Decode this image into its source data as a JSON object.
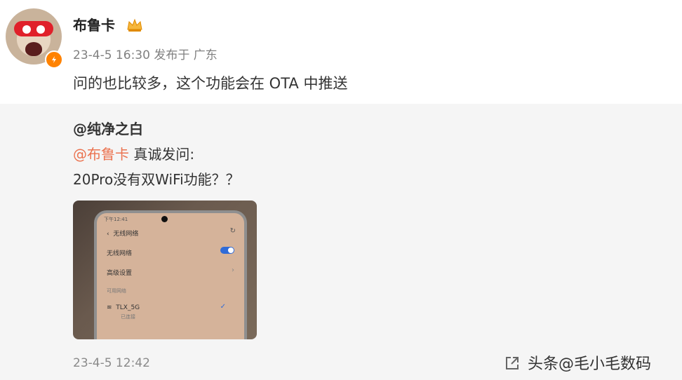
{
  "post": {
    "username": "布鲁卡",
    "meta": "23-4-5 16:30 发布于 广东",
    "text": "问的也比较多，这个功能会在 OTA 中推送"
  },
  "quote": {
    "author": "@纯净之白",
    "mention": "@布鲁卡",
    "line1_rest": " 真诚发问:",
    "line2": "20Pro没有双WiFi功能？？",
    "time": "23-4-5 12:42",
    "photo": {
      "status": "下午12:41",
      "title": "无线网络",
      "row1": "无线网络",
      "row2": "高级设置",
      "section": "可用网络",
      "network": "TLX_5G",
      "network_status": "已连接"
    }
  },
  "watermark": "头条@毛小毛数码",
  "colors": {
    "mention": "#eb7350",
    "verified": "#ff8200"
  }
}
